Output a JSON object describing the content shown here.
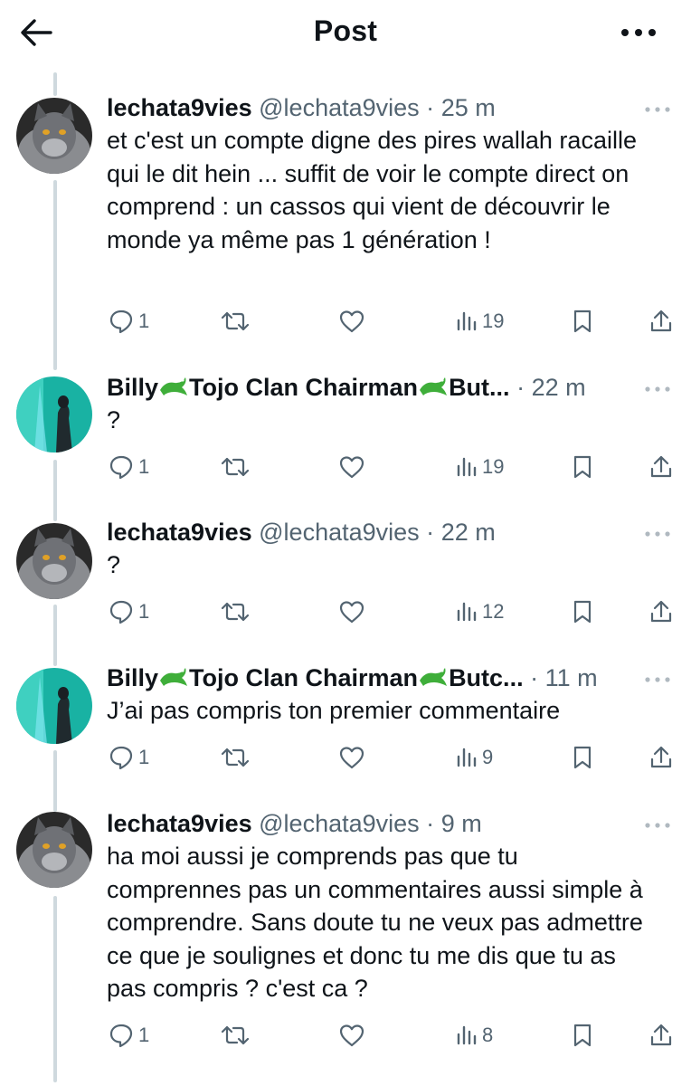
{
  "header": {
    "title": "Post"
  },
  "replies": [
    {
      "name": "lechata9vies",
      "handle": "@lechata9vies",
      "time": "25 m",
      "text": "et c'est un compte digne des pires wallah racaille qui le dit hein ... suffit de voir le compte direct on comprend : un cassos qui vient de découvrir le monde ya même pas 1 génération !",
      "reply_count": "1",
      "views": "19"
    },
    {
      "name_a": "Billy",
      "name_b": "Tojo Clan Chairman",
      "name_c": "But...",
      "emoji": "crocodile-icon",
      "time": "22 m",
      "text": "?",
      "reply_count": "1",
      "views": "19"
    },
    {
      "name": "lechata9vies",
      "handle": "@lechata9vies",
      "time": "22 m",
      "text": "?",
      "reply_count": "1",
      "views": "12"
    },
    {
      "name_a": "Billy",
      "name_b": "Tojo Clan Chairman",
      "name_c": "Butc...",
      "emoji": "crocodile-icon",
      "time": "11 m",
      "text": "J’ai pas compris ton premier commentaire",
      "reply_count": "1",
      "views": "9"
    },
    {
      "name": "lechata9vies",
      "handle": "@lechata9vies",
      "time": "9 m",
      "text": "ha moi aussi je comprends pas que tu comprennes pas un commentaires aussi simple à comprendre. Sans doute tu ne veux pas admettre ce que je soulignes et donc tu me dis que tu as pas compris ? c'est ca ?",
      "reply_count": "1",
      "views": "8"
    }
  ],
  "separator": "·",
  "colors": {
    "text": "#0f1419",
    "secondary": "#536471",
    "thread_line": "#cfd9de",
    "croc": "#3fae3a"
  }
}
